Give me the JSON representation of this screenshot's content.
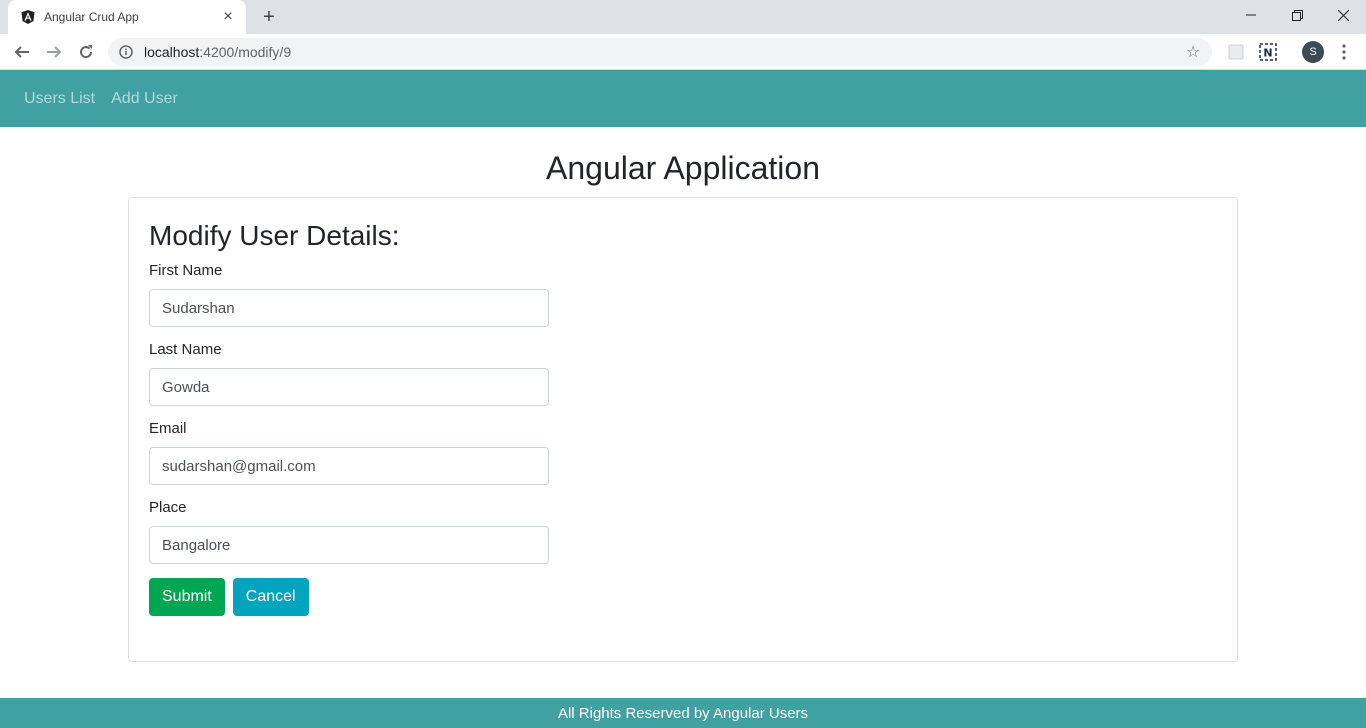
{
  "browser": {
    "tab_title": "Angular Crud App",
    "url_host": "localhost",
    "url_path": ":4200/modify/9",
    "avatar_letter": "S",
    "extension_label": "N"
  },
  "nav": {
    "items": [
      {
        "label": "Users List"
      },
      {
        "label": "Add User"
      }
    ]
  },
  "page": {
    "title": "Angular Application"
  },
  "form": {
    "heading": "Modify User Details:",
    "fields": [
      {
        "label": "First Name",
        "value": "Sudarshan"
      },
      {
        "label": "Last Name",
        "value": "Gowda"
      },
      {
        "label": "Email",
        "value": "sudarshan@gmail.com"
      },
      {
        "label": "Place",
        "value": "Bangalore"
      }
    ],
    "submit_label": "Submit",
    "cancel_label": "Cancel"
  },
  "footer": {
    "text": "All Rights Reserved by Angular Users"
  },
  "colors": {
    "navbar": "#41a0a1",
    "submit": "#00a652",
    "cancel": "#00a4bd"
  }
}
